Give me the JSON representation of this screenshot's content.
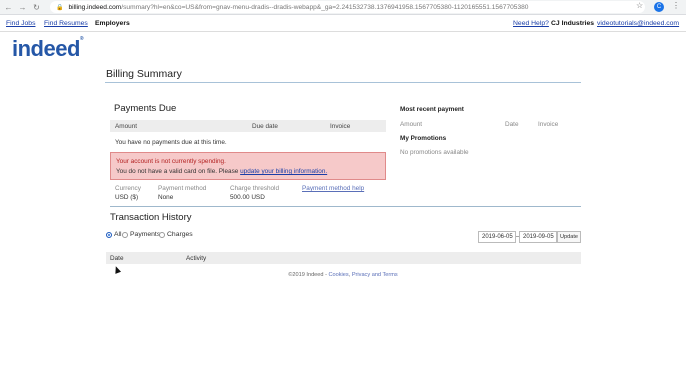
{
  "browser": {
    "url_host": "billing.indeed.com",
    "url_path": "/summary?hl=en&co=US&from=gnav-menu-dradis--dradis-webapp&_ga=2.241532738.1376941958.1567705380-1120165551.1567705380",
    "profile_initial": "C"
  },
  "topnav": {
    "find_jobs": "Find Jobs",
    "find_resumes": "Find Resumes",
    "employers": "Employers",
    "need_help": "Need Help?",
    "company": "CJ Industries",
    "email": "videotutorials@indeed.com"
  },
  "logo": {
    "text": "indeed",
    "mark": "®"
  },
  "page_title": "Billing Summary",
  "payments_due": {
    "heading": "Payments Due",
    "columns": [
      "Amount",
      "Due date",
      "Invoice"
    ],
    "empty_text": "You have no payments due at this time."
  },
  "alert": {
    "title": "Your account is not currently spending.",
    "body_prefix": "You do not have a valid card on file. Please ",
    "link": "update your billing information."
  },
  "account_info": {
    "currency_label": "Currency",
    "currency_value": "USD ($)",
    "payment_method_label": "Payment method",
    "payment_method_value": "None",
    "threshold_label": "Charge threshold",
    "threshold_value": "500.00 USD",
    "help_link": "Payment method help"
  },
  "recent_payment": {
    "heading": "Most recent payment",
    "columns": [
      "Amount",
      "Date",
      "Invoice"
    ]
  },
  "promotions": {
    "heading": "My Promotions",
    "empty_text": "No promotions available"
  },
  "transactions": {
    "heading": "Transaction History",
    "filters": [
      "All",
      "Payments",
      "Charges"
    ],
    "selected_filter": "All",
    "date_from": "2019-06-05",
    "date_sep": "–",
    "date_to": "2019-09-05",
    "update_label": "Update",
    "columns": [
      "Date",
      "Activity"
    ]
  },
  "footer": {
    "text": "©2019 Indeed - ",
    "cookies": "Cookies",
    "sep": ", ",
    "privacy": "Privacy and Terms"
  }
}
